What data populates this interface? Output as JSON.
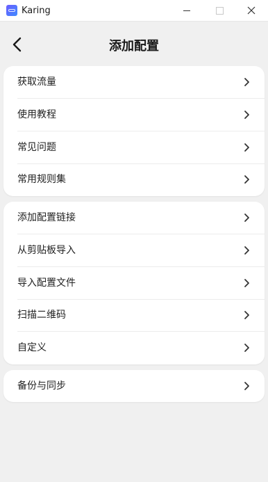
{
  "window": {
    "app_name": "Karing"
  },
  "header": {
    "title": "添加配置"
  },
  "groups": [
    {
      "items": [
        {
          "label": "获取流量"
        },
        {
          "label": "使用教程"
        },
        {
          "label": "常见问题"
        },
        {
          "label": "常用规则集"
        }
      ]
    },
    {
      "items": [
        {
          "label": "添加配置链接"
        },
        {
          "label": "从剪贴板导入"
        },
        {
          "label": "导入配置文件"
        },
        {
          "label": "扫描二维码"
        },
        {
          "label": "自定义"
        }
      ]
    },
    {
      "items": [
        {
          "label": "备份与同步"
        }
      ]
    }
  ],
  "icons": {
    "app": "karing-app-icon",
    "back": "arrow-left-icon",
    "row_chevron": "chevron-right-icon",
    "minimize": "minimize-icon",
    "maximize": "maximize-icon",
    "close": "close-icon"
  },
  "colors": {
    "background": "#f0f0f0",
    "card": "#ffffff",
    "divider": "#ececec",
    "text": "#222222"
  }
}
